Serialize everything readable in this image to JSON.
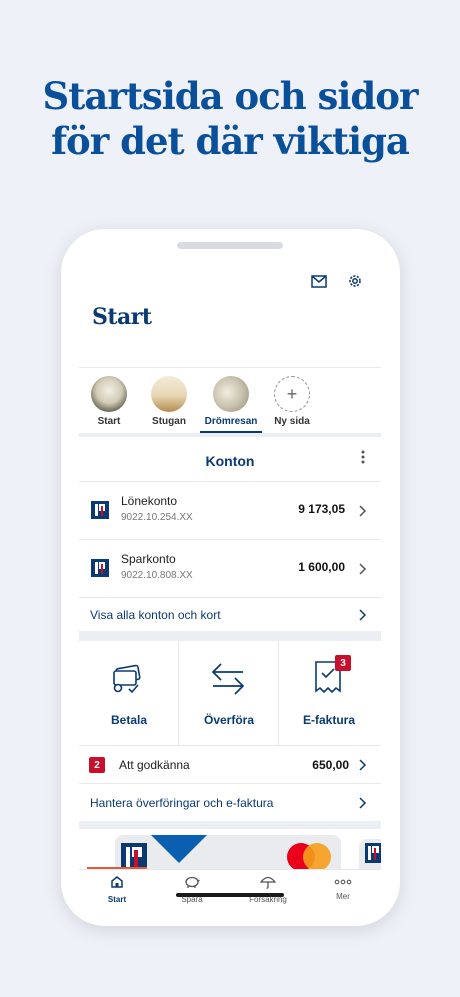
{
  "headline": {
    "line1": "Startsida och sidor",
    "line2": "för det där viktiga"
  },
  "header": {
    "title": "Start",
    "mail_icon": "mail-icon",
    "settings_icon": "gear-icon"
  },
  "pages": [
    {
      "label": "Start"
    },
    {
      "label": "Stugan"
    },
    {
      "label": "Drömresan"
    },
    {
      "label": "Ny sida",
      "symbol": "+"
    }
  ],
  "accounts": {
    "title": "Konton",
    "items": [
      {
        "name": "Lönekonto",
        "number": "9022.10.254.XX",
        "balance": "9 173,05"
      },
      {
        "name": "Sparkonto",
        "number": "9022.10.808.XX",
        "balance": "1 600,00"
      }
    ],
    "show_all": "Visa alla konton och kort"
  },
  "actions": {
    "items": [
      {
        "label": "Betala",
        "icon": "pay-icon"
      },
      {
        "label": "Överföra",
        "icon": "transfer-icon"
      },
      {
        "label": "E-faktura",
        "icon": "e-invoice-icon",
        "badge": "3"
      }
    ],
    "approve": {
      "count": "2",
      "label": "Att godkänna",
      "amount": "650,00"
    },
    "manage": "Hantera överföringar och e-faktura"
  },
  "tabbar": [
    {
      "label": "Start",
      "icon": "home-icon"
    },
    {
      "label": "Spara",
      "icon": "piggy-bank-icon"
    },
    {
      "label": "Försäkring",
      "icon": "umbrella-icon"
    },
    {
      "label": "Mer",
      "icon": "more-dots-icon"
    }
  ],
  "colors": {
    "brand": "#0b3a73",
    "headline": "#0a4f9a",
    "alert": "#c8102e"
  }
}
